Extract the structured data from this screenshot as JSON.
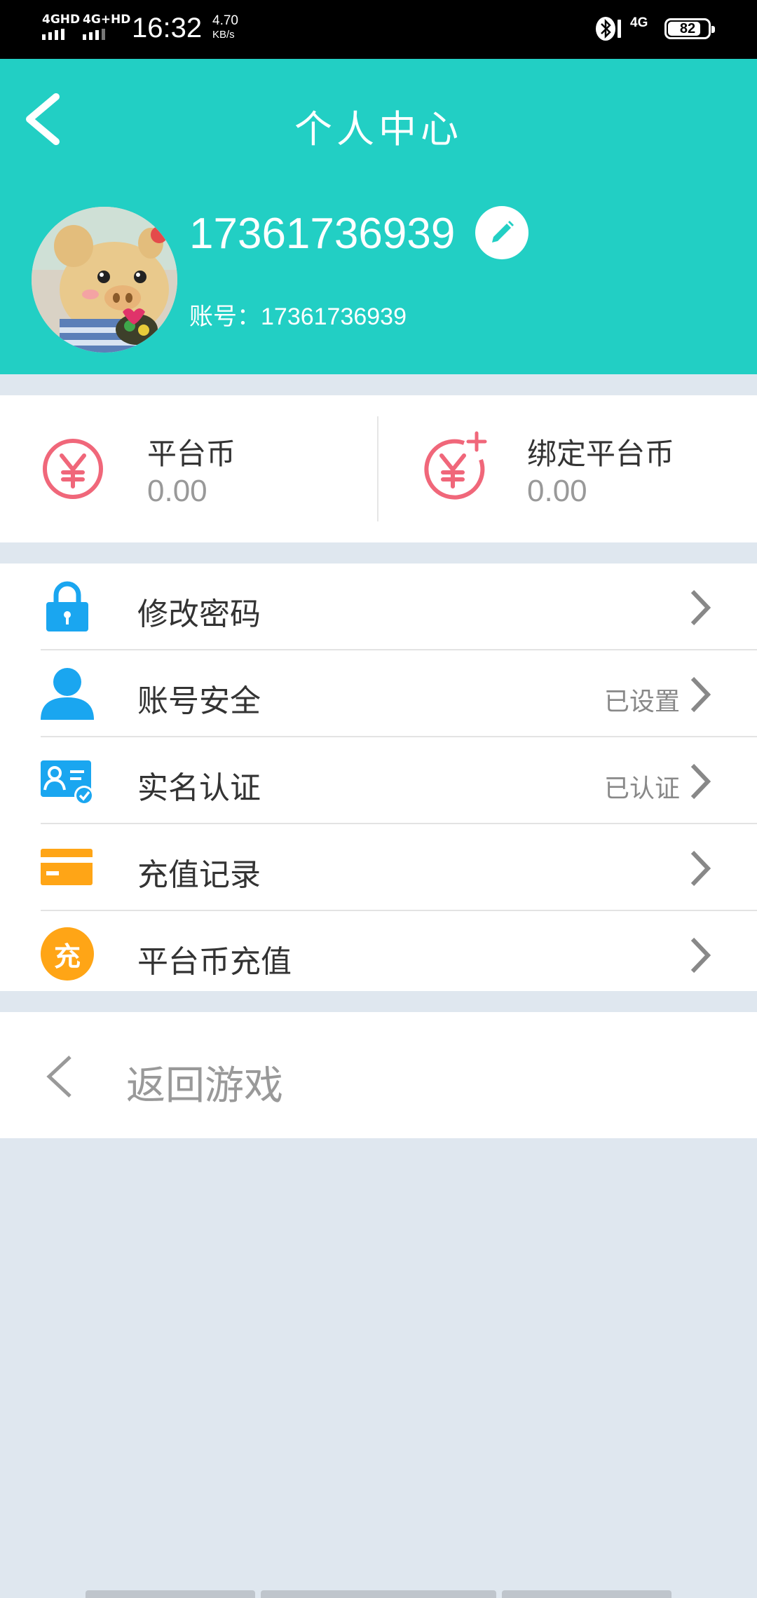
{
  "status_bar": {
    "sim1": "4GHD",
    "sim2": "4G+HD",
    "time": "16:32",
    "speed_value": "4.70",
    "speed_unit": "KB/s",
    "network": "4G",
    "battery": "82"
  },
  "header": {
    "title": "个人中心",
    "username": "17361736939",
    "account_label": "账号：",
    "account_number": "17361736939",
    "background_color": "#22cfc4"
  },
  "coins": [
    {
      "label": "平台币",
      "value": "0.00",
      "icon": "yuan-coin-icon"
    },
    {
      "label": "绑定平台币",
      "value": "0.00",
      "icon": "yuan-coin-plus-icon"
    }
  ],
  "menu": [
    {
      "label": "修改密码",
      "status": "",
      "icon": "lock-icon"
    },
    {
      "label": "账号安全",
      "status": "已设置",
      "icon": "user-icon"
    },
    {
      "label": "实名认证",
      "status": "已认证",
      "icon": "id-card-icon"
    },
    {
      "label": "充值记录",
      "status": "",
      "icon": "card-icon"
    },
    {
      "label": "平台币充值",
      "status": "",
      "icon": "recharge-icon",
      "icon_text": "充"
    }
  ],
  "return_game": {
    "label": "返回游戏",
    "icon": "chevron-left-icon"
  },
  "colors": {
    "accent": "#22cfc4",
    "coin_icon": "#f0677a",
    "menu_blue": "#1aa6f0",
    "menu_orange": "#ffa516"
  }
}
